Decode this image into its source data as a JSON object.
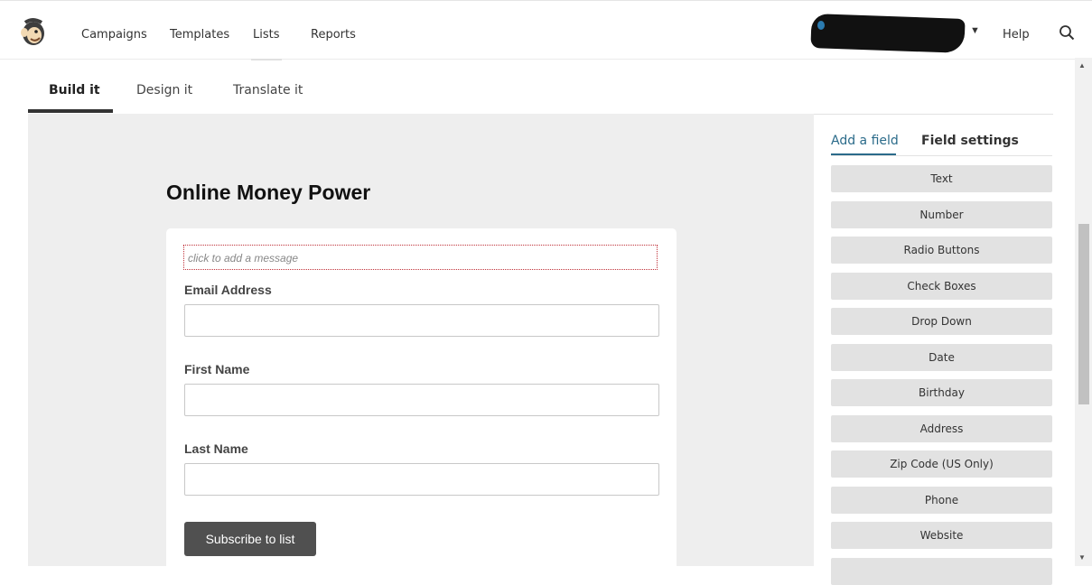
{
  "nav": {
    "items": [
      "Campaigns",
      "Templates",
      "Lists",
      "Reports"
    ],
    "help": "Help"
  },
  "builder_tabs": [
    "Build it",
    "Design it",
    "Translate it"
  ],
  "form": {
    "title": "Online Money Power",
    "message_placeholder": "click to add a message",
    "fields": [
      "Email Address",
      "First Name",
      "Last Name"
    ],
    "submit_label": "Subscribe to list"
  },
  "panel": {
    "tabs": [
      "Add a field",
      "Field settings"
    ],
    "field_types": [
      "Text",
      "Number",
      "Radio Buttons",
      "Check Boxes",
      "Drop Down",
      "Date",
      "Birthday",
      "Address",
      "Zip Code (US Only)",
      "Phone",
      "Website"
    ]
  },
  "colors": {
    "accent": "#2b6b8a",
    "canvas_bg": "#eeeeee",
    "button_bg": "#505050",
    "field_button_bg": "#e2e2e2"
  }
}
